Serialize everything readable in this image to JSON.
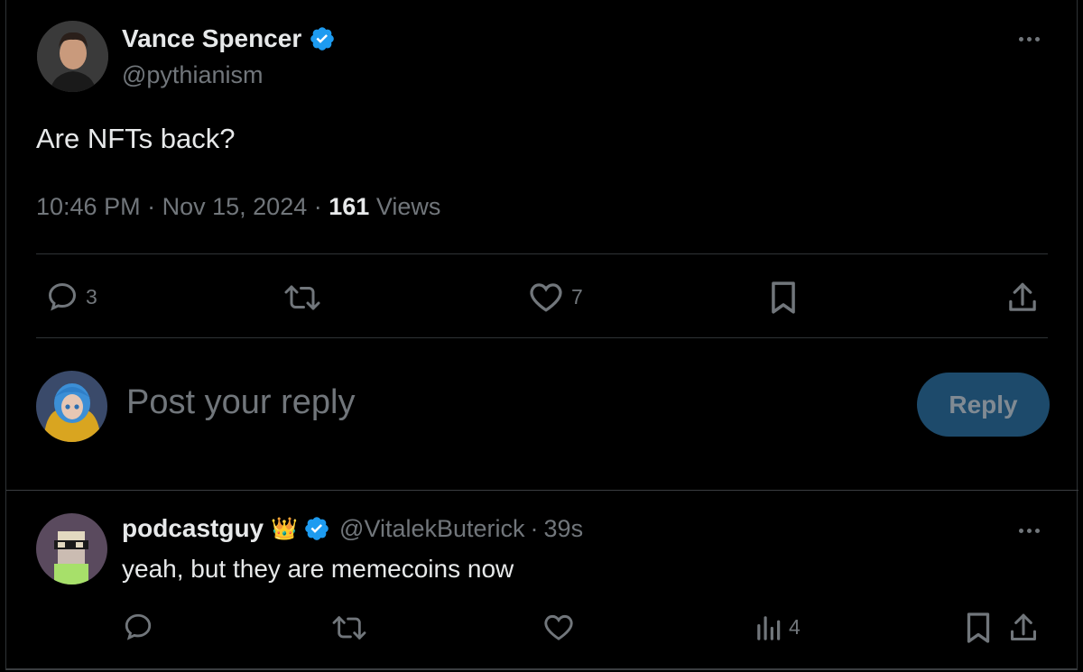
{
  "tweet": {
    "author_name": "Vance Spencer",
    "handle": "@pythianism",
    "verified": true,
    "text": "Are NFTs back?",
    "time": "10:46 PM",
    "date": "Nov 15, 2024",
    "views_count": "161",
    "views_label": "Views",
    "separator": "·",
    "actions": {
      "reply_count": "3",
      "like_count": "7"
    }
  },
  "composer": {
    "placeholder": "Post your reply",
    "reply_button": "Reply"
  },
  "reply": {
    "author_name": "podcastguy",
    "badge_emoji": "👑",
    "verified": true,
    "handle": "@VitalekButerick",
    "separator": "·",
    "age": "39s",
    "text": "yeah, but they are memecoins now",
    "actions": {
      "views_count": "4"
    }
  },
  "colors": {
    "background": "#000000",
    "text": "#e7e9ea",
    "muted": "#71767b",
    "verified": "#1d9bf0",
    "reply_button_bg": "#1d4a6b"
  }
}
